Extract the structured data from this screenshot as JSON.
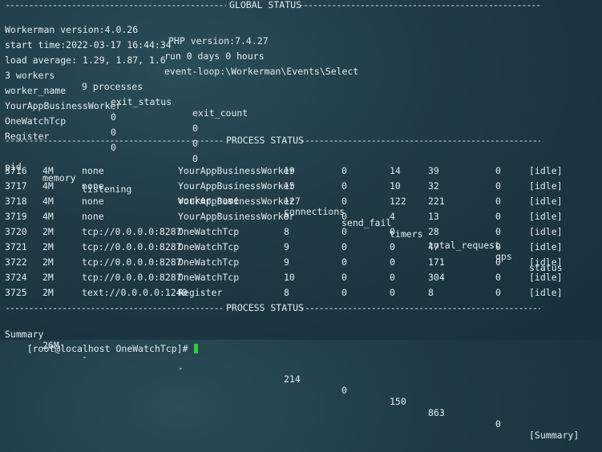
{
  "global": {
    "sep_title": "GLOBAL STATUS",
    "workerman_version": "Workerman version:4.0.26",
    "php_version": "PHP version:7.4.27",
    "start_time": "start time:2022-03-17 16:44:34",
    "run_time": "run 0 days 0 hours",
    "load_average": "load average: 1.29, 1.87, 1.6",
    "event_loop": "event-loop:\\Workerman\\Events\\Select",
    "workers": "3 workers",
    "processes": "9 processes",
    "worker_headers": [
      "worker_name",
      "exit_status",
      "exit_count"
    ],
    "workers_rows": [
      [
        "YourAppBusinessWorker",
        "0",
        "0"
      ],
      [
        "OneWatchTcp",
        "0",
        "0"
      ],
      [
        "Register",
        "0",
        "0"
      ]
    ]
  },
  "process": {
    "sep_title": "PROCESS STATUS",
    "headers": [
      "pid",
      "memory",
      "listening",
      "worker_name",
      "connections",
      "send_fail",
      "timers",
      "total_request",
      "qps",
      "status"
    ],
    "rows": [
      [
        "3716",
        "4M",
        "none",
        "YourAppBusinessWorker",
        "19",
        "0",
        "14",
        "39",
        "0",
        "[idle]"
      ],
      [
        "3717",
        "4M",
        "none",
        "YourAppBusinessWorker",
        "15",
        "0",
        "10",
        "32",
        "0",
        "[idle]"
      ],
      [
        "3718",
        "4M",
        "none",
        "YourAppBusinessWorker",
        "127",
        "0",
        "122",
        "221",
        "0",
        "[idle]"
      ],
      [
        "3719",
        "4M",
        "none",
        "YourAppBusinessWorker",
        "9",
        "0",
        "4",
        "13",
        "0",
        "[idle]"
      ],
      [
        "3720",
        "2M",
        "tcp://0.0.0.0:8287",
        "OneWatchTcp",
        "8",
        "0",
        "0",
        "28",
        "0",
        "[idle]"
      ],
      [
        "3721",
        "2M",
        "tcp://0.0.0.0:8287",
        "OneWatchTcp",
        "9",
        "0",
        "0",
        "47",
        "0",
        "[idle]"
      ],
      [
        "3722",
        "2M",
        "tcp://0.0.0.0:8287",
        "OneWatchTcp",
        "9",
        "0",
        "0",
        "171",
        "0",
        "[idle]"
      ],
      [
        "3724",
        "2M",
        "tcp://0.0.0.0:8287",
        "OneWatchTcp",
        "10",
        "0",
        "0",
        "304",
        "0",
        "[idle]"
      ],
      [
        "3725",
        "2M",
        "text://0.0.0.0:1240",
        "Register",
        "8",
        "0",
        "0",
        "8",
        "0",
        "[idle]"
      ]
    ],
    "summary_sep_title": "PROCESS STATUS",
    "summary": [
      "Summary",
      "26M",
      "-",
      "-",
      "214",
      "0",
      "150",
      "863",
      "0",
      "[Summary]"
    ]
  },
  "prompt": {
    "text": "[root@localhost OneWatchTcp]# "
  },
  "colors": {
    "background": "#1f3a45",
    "text": "#e4eaec",
    "cursor": "#2ecc40"
  }
}
